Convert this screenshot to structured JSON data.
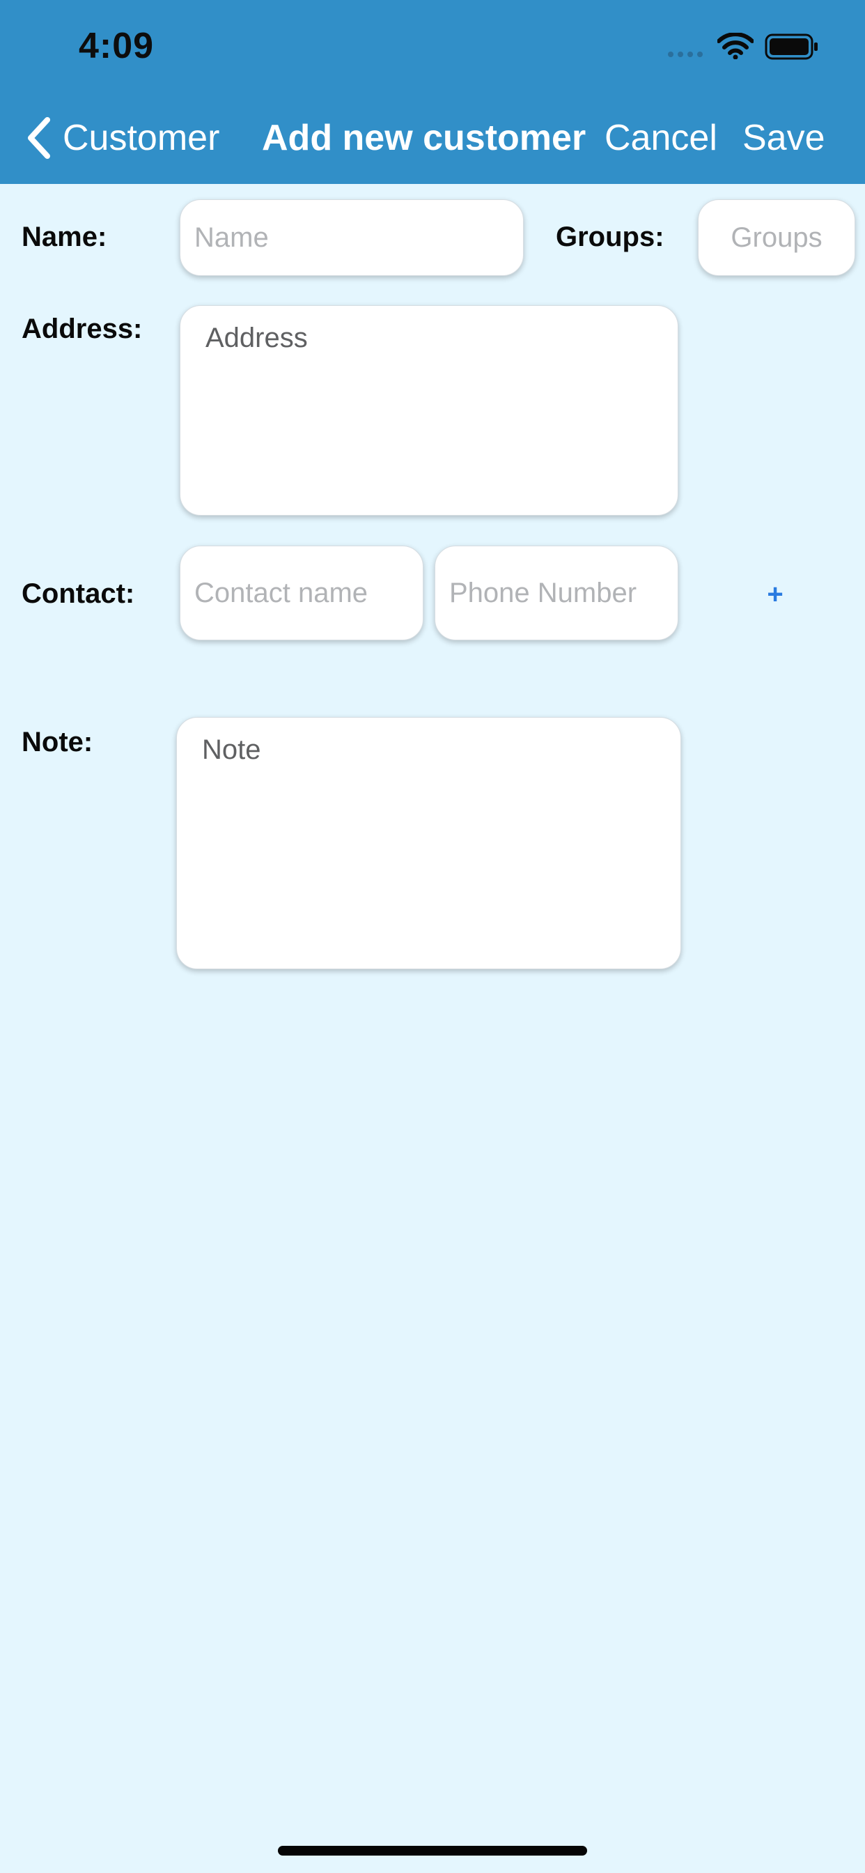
{
  "status_bar": {
    "time": "4:09",
    "signal_icon": "signal-dots-icon",
    "wifi_icon": "wifi-icon",
    "battery_icon": "battery-icon"
  },
  "nav": {
    "back_icon": "chevron-left-icon",
    "back_label": "Customer",
    "title": "Add new customer",
    "cancel_label": "Cancel",
    "save_label": "Save"
  },
  "form": {
    "name": {
      "label": "Name:",
      "placeholder": "Name",
      "value": ""
    },
    "groups": {
      "label": "Groups:",
      "placeholder": "Groups",
      "value": ""
    },
    "address": {
      "label": "Address:",
      "placeholder": "Address",
      "value": ""
    },
    "contact": {
      "label": "Contact:",
      "name_placeholder": "Contact name",
      "phone_placeholder": "Phone Number",
      "add_label": "+"
    },
    "note": {
      "label": "Note:",
      "placeholder": "Note",
      "value": ""
    }
  },
  "colors": {
    "header": "#318fc8",
    "background": "#e4f6fe",
    "accent": "#2a7be0"
  }
}
